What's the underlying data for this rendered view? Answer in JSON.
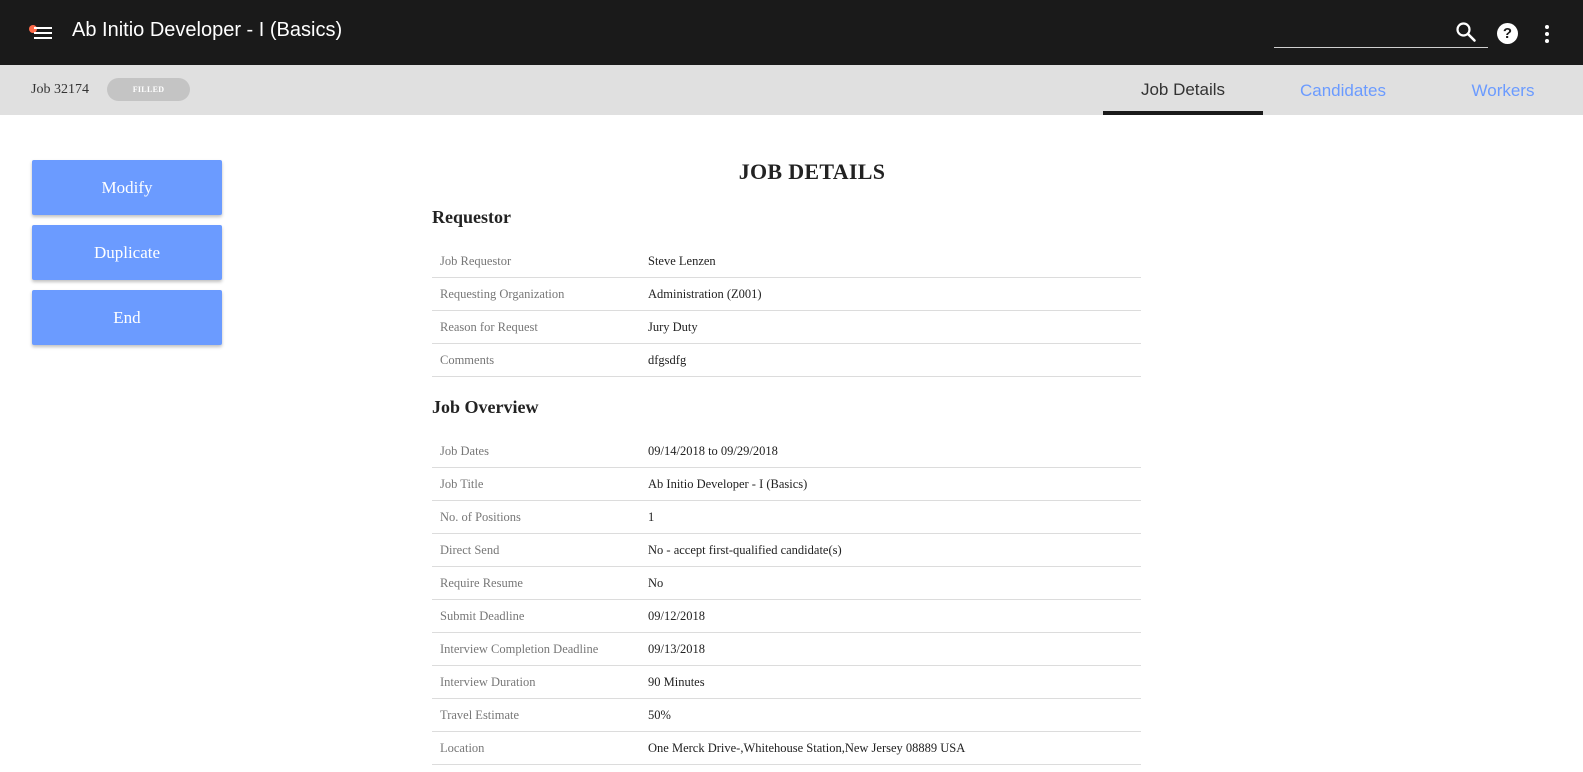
{
  "app": {
    "title": "Ab Initio Developer - I (Basics)"
  },
  "search": {
    "value": "",
    "placeholder": ""
  },
  "job": {
    "number": "Job 32174",
    "status": "FILLED"
  },
  "tabs": [
    {
      "label": "Job Details",
      "active": true
    },
    {
      "label": "Candidates",
      "active": false
    },
    {
      "label": "Workers",
      "active": false
    }
  ],
  "actions": {
    "modify": "Modify",
    "duplicate": "Duplicate",
    "end": "End"
  },
  "page": {
    "title": "JOB DETAILS"
  },
  "requestor": {
    "heading": "Requestor",
    "rows": [
      {
        "label": "Job Requestor",
        "value": "Steve Lenzen"
      },
      {
        "label": "Requesting Organization",
        "value": "Administration (Z001)"
      },
      {
        "label": "Reason for Request",
        "value": "Jury Duty"
      },
      {
        "label": "Comments",
        "value": "dfgsdfg"
      }
    ]
  },
  "overview": {
    "heading": "Job Overview",
    "rows": [
      {
        "label": "Job Dates",
        "value": "09/14/2018 to 09/29/2018"
      },
      {
        "label": "Job Title",
        "value": "Ab Initio Developer - I (Basics)"
      },
      {
        "label": "No. of Positions",
        "value": "1"
      },
      {
        "label": "Direct Send",
        "value": "No - accept first-qualified candidate(s)"
      },
      {
        "label": "Require Resume",
        "value": "No"
      },
      {
        "label": "Submit Deadline",
        "value": "09/12/2018"
      },
      {
        "label": "Interview Completion Deadline",
        "value": "09/13/2018"
      },
      {
        "label": "Interview Duration",
        "value": "90 Minutes"
      },
      {
        "label": "Travel Estimate",
        "value": "50%"
      },
      {
        "label": "Location",
        "value": "One Merck Drive-,Whitehouse Station,New Jersey 08889 USA"
      }
    ]
  },
  "colors": {
    "appbar": "#1a1a1a",
    "accent": "#6b9bff",
    "subbar": "#e0e0e0",
    "notification_dot": "#ff6b4a"
  },
  "icons": {
    "menu": "hamburger-icon",
    "search": "search-icon",
    "help": "help-icon",
    "more": "more-vert-icon"
  }
}
